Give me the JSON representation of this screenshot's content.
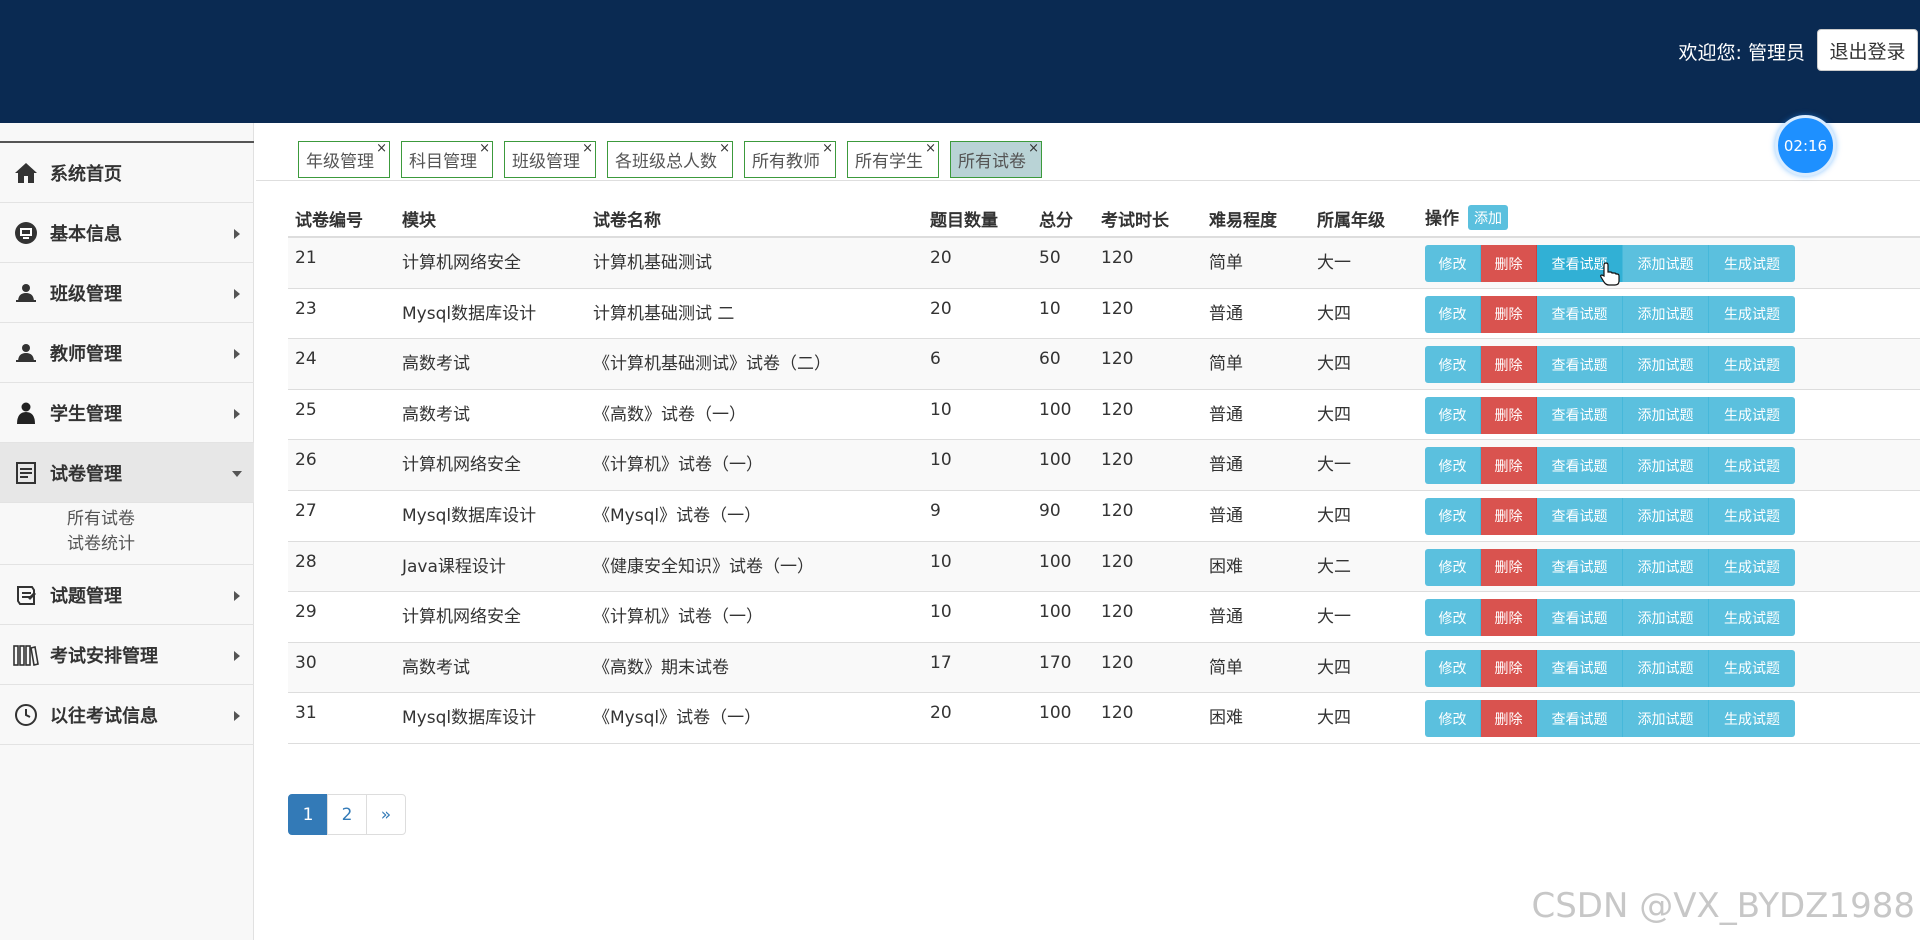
{
  "header": {
    "welcome": "欢迎您: 管理员",
    "logout_label": "退出登录",
    "background": "#0a2a52"
  },
  "sidebar": {
    "items": [
      {
        "label": "系统首页",
        "icon": "home-icon",
        "caret": "none"
      },
      {
        "label": "基本信息",
        "icon": "monitor-icon",
        "caret": "right"
      },
      {
        "label": "班级管理",
        "icon": "user-group-icon",
        "caret": "right"
      },
      {
        "label": "教师管理",
        "icon": "user-group-icon",
        "caret": "right"
      },
      {
        "label": "学生管理",
        "icon": "user-icon",
        "caret": "right"
      },
      {
        "label": "试卷管理",
        "icon": "document-icon",
        "caret": "down",
        "active": true,
        "sub": [
          "所有试卷",
          "试卷统计"
        ]
      },
      {
        "label": "试题管理",
        "icon": "scroll-icon",
        "caret": "right"
      },
      {
        "label": "考试安排管理",
        "icon": "books-icon",
        "caret": "right"
      },
      {
        "label": "以往考试信息",
        "icon": "clock-icon",
        "caret": "right"
      }
    ]
  },
  "tabs": [
    {
      "label": "年级管理",
      "active": false
    },
    {
      "label": "科目管理",
      "active": false
    },
    {
      "label": "班级管理",
      "active": false
    },
    {
      "label": "各班级总人数",
      "active": false
    },
    {
      "label": "所有教师",
      "active": false
    },
    {
      "label": "所有学生",
      "active": false
    },
    {
      "label": "所有试卷",
      "active": true
    }
  ],
  "tab_close_glyph": "×",
  "timer": "02:16",
  "table": {
    "headers": [
      "试卷编号",
      "模块",
      "试卷名称",
      "题目数量",
      "总分",
      "考试时长",
      "难易程度",
      "所属年级",
      "操作"
    ],
    "add_label": "添加",
    "action_labels": [
      "修改",
      "删除",
      "查看试题",
      "添加试题",
      "生成试题"
    ],
    "rows": [
      [
        "21",
        "计算机网络安全",
        "计算机基础测试",
        "20",
        "50",
        "120",
        "简单",
        "大一"
      ],
      [
        "23",
        "Mysql数据库设计",
        "计算机基础测试 二",
        "20",
        "10",
        "120",
        "普通",
        "大四"
      ],
      [
        "24",
        "高数考试",
        "《计算机基础测试》试卷（二）",
        "6",
        "60",
        "120",
        "简单",
        "大四"
      ],
      [
        "25",
        "高数考试",
        "《高数》试卷（一）",
        "10",
        "100",
        "120",
        "普通",
        "大四"
      ],
      [
        "26",
        "计算机网络安全",
        "《计算机》试卷（一）",
        "10",
        "100",
        "120",
        "普通",
        "大一"
      ],
      [
        "27",
        "Mysql数据库设计",
        "《Mysql》试卷（一）",
        "9",
        "90",
        "120",
        "普通",
        "大四"
      ],
      [
        "28",
        "Java课程设计",
        "《健康安全知识》试卷（一）",
        "10",
        "100",
        "120",
        "困难",
        "大二"
      ],
      [
        "29",
        "计算机网络安全",
        "《计算机》试卷（一）",
        "10",
        "100",
        "120",
        "普通",
        "大一"
      ],
      [
        "30",
        "高数考试",
        "《高数》期末试卷",
        "17",
        "170",
        "120",
        "简单",
        "大四"
      ],
      [
        "31",
        "Mysql数据库设计",
        "《Mysql》试卷（一）",
        "20",
        "100",
        "120",
        "困难",
        "大四"
      ]
    ]
  },
  "pagination": {
    "pages": [
      "1",
      "2",
      "»"
    ],
    "current": "1"
  },
  "watermark": "CSDN @VX_BYDZ1988",
  "colors": {
    "info": "#5bc0de",
    "danger": "#d9534f",
    "primary": "#337ab7",
    "tab_border": "#3c9a3c"
  }
}
